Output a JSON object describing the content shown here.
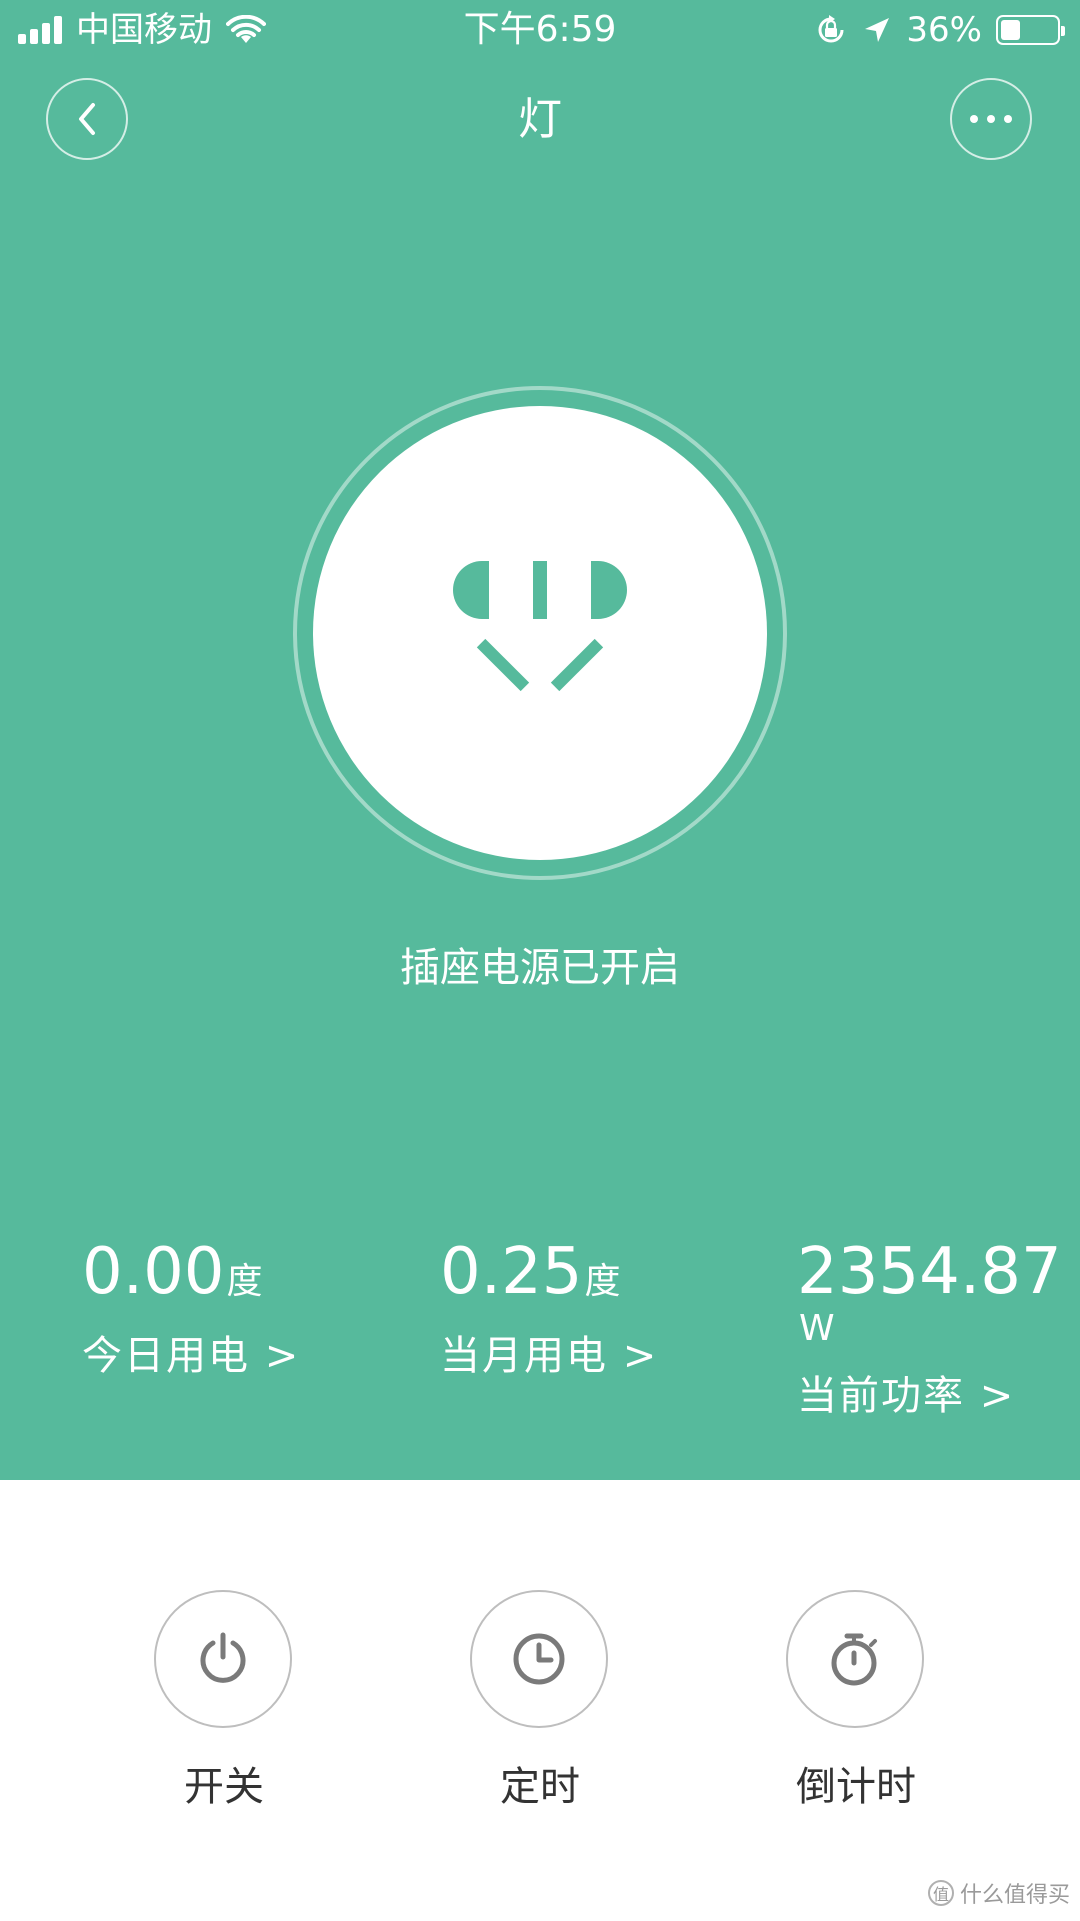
{
  "status_bar": {
    "carrier": "中国移动",
    "time": "下午6:59",
    "battery_percent_text": "36%",
    "battery_level": 0.36,
    "icons": [
      "signal-icon",
      "wifi-icon",
      "rotation-lock-icon",
      "location-arrow-icon",
      "battery-icon"
    ]
  },
  "header": {
    "title": "灯",
    "back_icon": "chevron-left-icon",
    "more_icon": "more-horizontal-icon"
  },
  "device": {
    "icon": "power-socket-icon",
    "status_text": "插座电源已开启"
  },
  "stats": [
    {
      "value": "0.00",
      "unit": "度",
      "label": "今日用电 >"
    },
    {
      "value": "0.25",
      "unit": "度",
      "label": "当月用电 >"
    },
    {
      "value": "2354.87",
      "unit": "W",
      "label": "当前功率 >"
    }
  ],
  "controls": [
    {
      "label": "开关",
      "icon": "power-icon"
    },
    {
      "label": "定时",
      "icon": "clock-icon"
    },
    {
      "label": "倒计时",
      "icon": "stopwatch-icon"
    }
  ],
  "watermark": {
    "text": "什么值得买",
    "badge": "值"
  },
  "colors": {
    "primary_green": "#56BA9C",
    "white": "#FFFFFF",
    "icon_gray": "#7A7A7A",
    "label_dark": "#333333"
  }
}
